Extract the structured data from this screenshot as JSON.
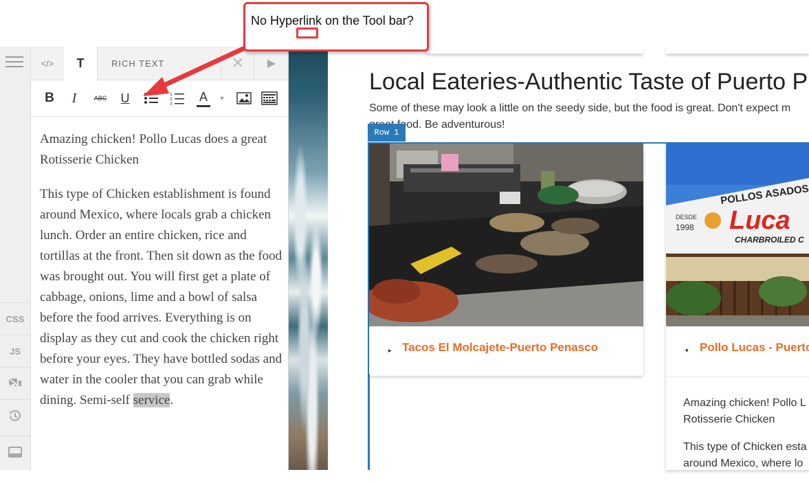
{
  "annotation": {
    "text": "No  Hyperlink on the Tool bar?"
  },
  "left_rail": {
    "css": "CSS",
    "js": "JS"
  },
  "editor": {
    "tab_title": "RICH TEXT",
    "tab_text_glyph": "T",
    "tab_code_glyph": "</>",
    "toolbar": {
      "bold": "B",
      "italic": "I",
      "strike": "ABC",
      "underline": "U",
      "font_color": "A"
    },
    "paragraph1": "Amazing chicken! Pollo Lucas does a great Rotisserie Chicken",
    "paragraph2_main": "This type of Chicken establishment is found around Mexico, where locals grab a chicken lunch. Order an entire chicken, rice and tortillas at the front. Then sit down as the food was brought out. You will first get a plate of cabbage, onions, lime and a bowl of salsa before the food arrives. Everything is on display as they cut and cook the chicken right before your eyes. They have bottled sodas and water in the cooler that you can grab while dining. Semi-self ",
    "paragraph2_selected": "service",
    "paragraph2_end": "."
  },
  "page": {
    "title": "Local Eateries-Authentic  Taste of Puerto P",
    "subtitle": "Some of these may look a little on the seedy side, but the food is great. Don't expect m great food. Be adventurous!",
    "row_badge": "Row 1",
    "card1_title": "Tacos El Molcajete-Puerto Penasco",
    "card2_title": "Pollo Lucas - Puerto",
    "card2_sign": {
      "line1": "POLLOS ASADOS",
      "since": "DESDE",
      "year": "1998",
      "brand": "Luca",
      "line3": "CHARBROILED C"
    },
    "card2_p1": "Amazing chicken! Pollo L",
    "card2_p1b": "Rotisserie Chicken",
    "card2_p2": "This type of Chicken esta",
    "card2_p2b": "around Mexico, where lo"
  },
  "colors": {
    "accent_blue": "#2a7ab8",
    "title_orange": "#ee6a24",
    "annotation_red": "#e83a3e"
  }
}
